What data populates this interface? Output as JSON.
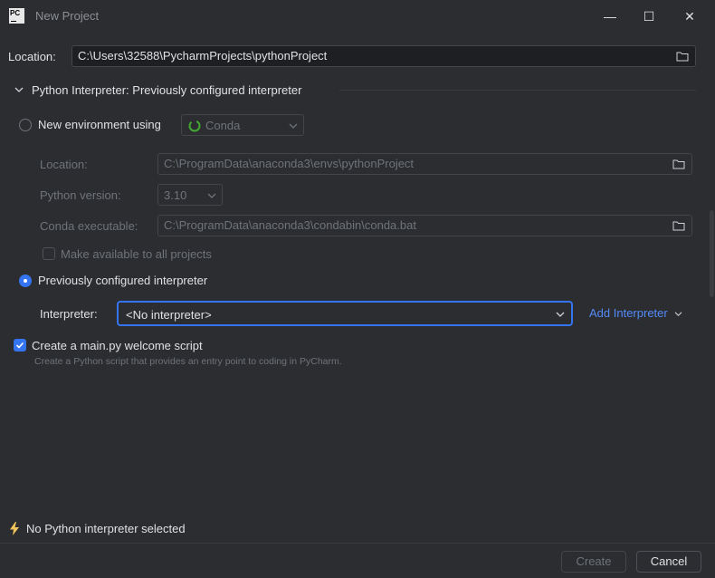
{
  "window": {
    "title": "New Project",
    "app_logo": "PC",
    "minimize_icon": "—",
    "maximize_icon": "☐",
    "close_icon": "✕"
  },
  "location": {
    "label": "Location:",
    "value": "C:\\Users\\32588\\PycharmProjects\\pythonProject"
  },
  "interpreter_section": {
    "header": "Python Interpreter: Previously configured interpreter",
    "new_env": {
      "label": "New environment using",
      "selected": false,
      "tool": "Conda",
      "location_label": "Location:",
      "location_value": "C:\\ProgramData\\anaconda3\\envs\\pythonProject",
      "python_version_label": "Python version:",
      "python_version_value": "3.10",
      "conda_exec_label": "Conda executable:",
      "conda_exec_value": "C:\\ProgramData\\anaconda3\\condabin\\conda.bat",
      "make_available_label": "Make available to all projects"
    },
    "previous": {
      "label": "Previously configured interpreter",
      "selected": true,
      "interpreter_label": "Interpreter:",
      "interpreter_value": "<No interpreter>",
      "add_interpreter": "Add Interpreter"
    }
  },
  "welcome_script": {
    "label": "Create a main.py welcome script",
    "checked": true,
    "description": "Create a Python script that provides an entry point to coding in PyCharm."
  },
  "status": {
    "message": "No Python interpreter selected",
    "icon": "lightning-icon"
  },
  "buttons": {
    "create": "Create",
    "cancel": "Cancel"
  },
  "colors": {
    "background": "#2b2d30",
    "field": "#1e1f22",
    "accent": "#3574f0",
    "link": "#548af7",
    "warning": "#f2c55c"
  }
}
